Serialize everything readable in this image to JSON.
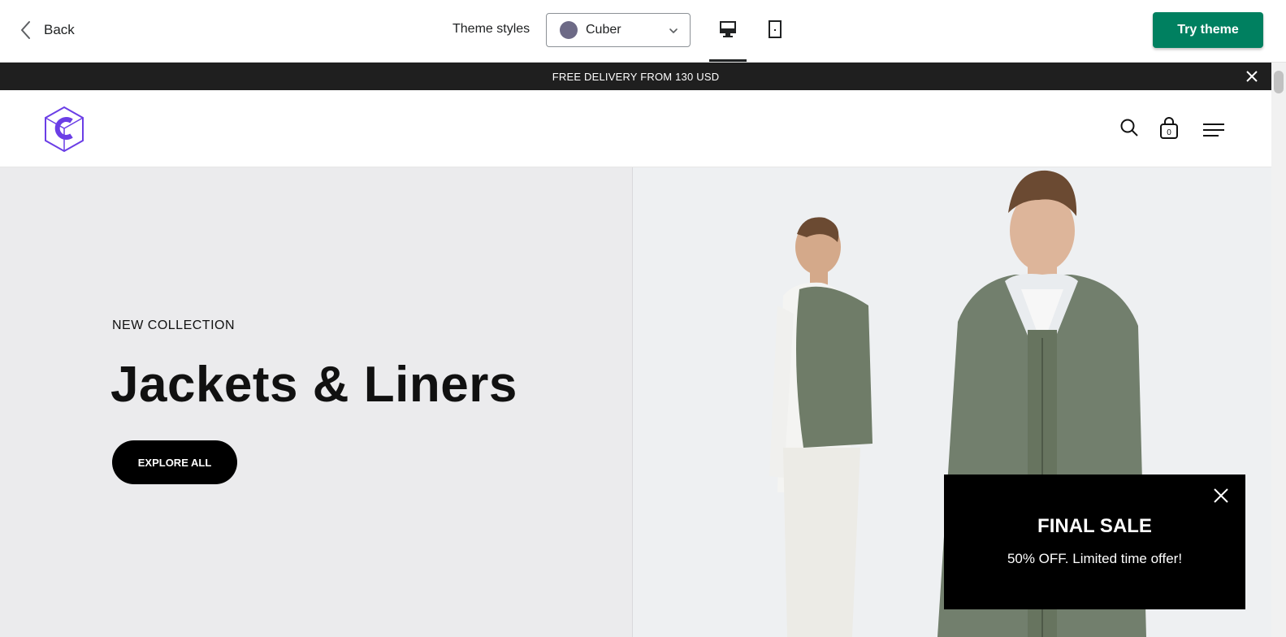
{
  "topbar": {
    "back_label": "Back",
    "theme_styles_label": "Theme styles",
    "theme_select_value": "Cuber",
    "try_button": "Try theme",
    "accent_color": "#008060",
    "swatch_color": "#6d6a86"
  },
  "announcement": {
    "text": "FREE DELIVERY FROM 130 USD"
  },
  "header": {
    "cart_count": "0",
    "logo_color": "#6b3ee6"
  },
  "hero": {
    "subtitle": "NEW COLLECTION",
    "headline": "Jackets & Liners",
    "cta": "EXPLORE ALL"
  },
  "popup": {
    "title": "FINAL SALE",
    "text": "50% OFF. Limited time offer!"
  }
}
